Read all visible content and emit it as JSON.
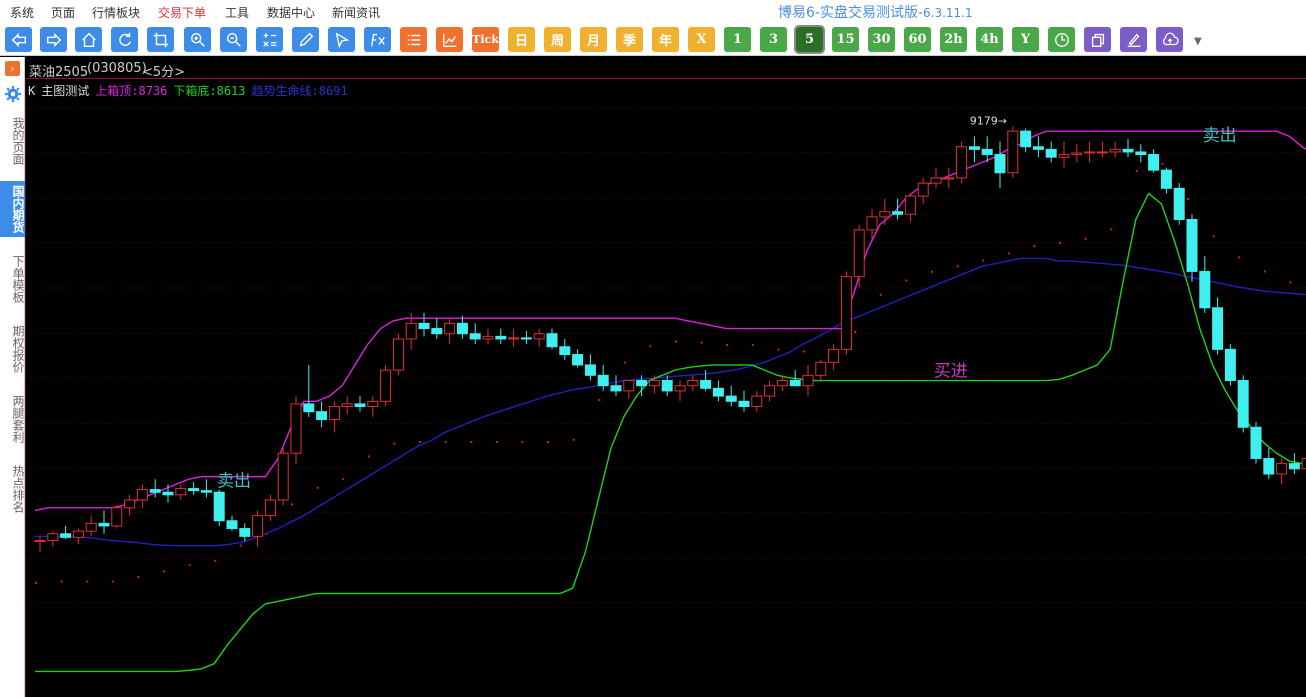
{
  "menu": [
    "系统",
    "页面",
    "行情板块",
    "交易下单",
    "工具",
    "数据中心",
    "新闻资讯"
  ],
  "menu_active": "交易下单",
  "app_title": "博易6-实盘交易测试版-",
  "app_version": "6.3.11.1",
  "toolbar": {
    "icons": [
      "back-icon",
      "forward-icon",
      "home-icon",
      "refresh-icon",
      "crop-icon",
      "zoom-in-icon",
      "zoom-out-icon",
      "formula-icon",
      "draw-icon",
      "cursor-icon",
      "function-icon",
      "list-icon",
      "trend-icon"
    ],
    "tick_label": "Tick",
    "periods": [
      "日",
      "周",
      "月",
      "季",
      "年"
    ],
    "minutes": [
      "X",
      "1",
      "3",
      "5",
      "15",
      "30",
      "60",
      "2h",
      "4h",
      "Y"
    ],
    "selected_minute": "5",
    "extra_icons": [
      "clock-icon",
      "layers-icon",
      "sign-icon",
      "upload-icon"
    ],
    "more": "▼"
  },
  "sidebar": {
    "toggle": "›",
    "items": [
      "我的页面",
      "国内期货",
      "下单模板",
      "期权报价",
      "两腿套利",
      "热点排名"
    ],
    "active_index": 1
  },
  "chart_header": {
    "symbol": "菜油2505",
    "code": "(030805)",
    "period": "<5分>"
  },
  "legend": {
    "k": "K",
    "title": "主图测试",
    "upper": "上箱顶:8736",
    "lower": "下箱底:8613",
    "trend": "趋势生命线:8691"
  },
  "colors": {
    "up": "#e03030",
    "down": "#40f0f0",
    "upper": "#e020e0",
    "lower": "#20d020",
    "trend": "#2020c0",
    "dots": "#d02020",
    "signal_sell": "#40c0c0",
    "signal_buy": "#c040c0"
  },
  "chart_data": {
    "type": "candlestick",
    "title": "主图测试",
    "peak_label": "9179",
    "signals": [
      {
        "label": "卖出",
        "bar": 15
      },
      {
        "label": "买进",
        "bar": 71
      },
      {
        "label": "卖出",
        "bar": 92
      }
    ],
    "ohlc": [
      [
        8380,
        8390,
        8360,
        8382
      ],
      [
        8382,
        8400,
        8370,
        8395
      ],
      [
        8395,
        8410,
        8385,
        8388
      ],
      [
        8388,
        8405,
        8375,
        8400
      ],
      [
        8400,
        8430,
        8390,
        8415
      ],
      [
        8415,
        8440,
        8395,
        8410
      ],
      [
        8410,
        8450,
        8405,
        8445
      ],
      [
        8445,
        8470,
        8430,
        8460
      ],
      [
        8460,
        8490,
        8445,
        8480
      ],
      [
        8480,
        8500,
        8465,
        8475
      ],
      [
        8475,
        8490,
        8455,
        8470
      ],
      [
        8470,
        8490,
        8460,
        8482
      ],
      [
        8482,
        8495,
        8470,
        8478
      ],
      [
        8478,
        8500,
        8465,
        8475
      ],
      [
        8475,
        8480,
        8410,
        8420
      ],
      [
        8420,
        8430,
        8400,
        8405
      ],
      [
        8405,
        8415,
        8380,
        8390
      ],
      [
        8390,
        8440,
        8370,
        8430
      ],
      [
        8430,
        8470,
        8420,
        8460
      ],
      [
        8460,
        8560,
        8450,
        8550
      ],
      [
        8550,
        8660,
        8530,
        8645
      ],
      [
        8645,
        8720,
        8620,
        8630
      ],
      [
        8630,
        8650,
        8600,
        8615
      ],
      [
        8615,
        8650,
        8590,
        8640
      ],
      [
        8640,
        8660,
        8625,
        8645
      ],
      [
        8645,
        8660,
        8630,
        8640
      ],
      [
        8640,
        8660,
        8620,
        8650
      ],
      [
        8650,
        8720,
        8640,
        8710
      ],
      [
        8710,
        8780,
        8700,
        8770
      ],
      [
        8770,
        8820,
        8750,
        8800
      ],
      [
        8800,
        8820,
        8775,
        8790
      ],
      [
        8790,
        8810,
        8770,
        8780
      ],
      [
        8780,
        8810,
        8760,
        8800
      ],
      [
        8800,
        8815,
        8770,
        8780
      ],
      [
        8780,
        8800,
        8760,
        8770
      ],
      [
        8770,
        8790,
        8760,
        8775
      ],
      [
        8775,
        8790,
        8760,
        8770
      ],
      [
        8770,
        8790,
        8755,
        8772
      ],
      [
        8772,
        8785,
        8760,
        8770
      ],
      [
        8770,
        8790,
        8755,
        8780
      ],
      [
        8780,
        8790,
        8750,
        8755
      ],
      [
        8755,
        8770,
        8730,
        8740
      ],
      [
        8740,
        8750,
        8715,
        8720
      ],
      [
        8720,
        8740,
        8690,
        8700
      ],
      [
        8700,
        8720,
        8670,
        8680
      ],
      [
        8680,
        8700,
        8660,
        8670
      ],
      [
        8670,
        8690,
        8655,
        8690
      ],
      [
        8690,
        8700,
        8660,
        8680
      ],
      [
        8680,
        8700,
        8665,
        8690
      ],
      [
        8690,
        8700,
        8660,
        8670
      ],
      [
        8670,
        8690,
        8650,
        8680
      ],
      [
        8680,
        8700,
        8670,
        8690
      ],
      [
        8690,
        8710,
        8670,
        8675
      ],
      [
        8675,
        8690,
        8650,
        8660
      ],
      [
        8660,
        8680,
        8640,
        8650
      ],
      [
        8650,
        8670,
        8630,
        8640
      ],
      [
        8640,
        8670,
        8630,
        8660
      ],
      [
        8660,
        8690,
        8650,
        8680
      ],
      [
        8680,
        8700,
        8670,
        8690
      ],
      [
        8690,
        8710,
        8680,
        8680
      ],
      [
        8680,
        8720,
        8660,
        8700
      ],
      [
        8700,
        8730,
        8690,
        8725
      ],
      [
        8725,
        8760,
        8710,
        8750
      ],
      [
        8750,
        8900,
        8740,
        8890
      ],
      [
        8890,
        8990,
        8870,
        8980
      ],
      [
        8980,
        9020,
        8960,
        9005
      ],
      [
        9005,
        9040,
        8990,
        9015
      ],
      [
        9015,
        9040,
        9000,
        9010
      ],
      [
        9010,
        9050,
        8995,
        9045
      ],
      [
        9045,
        9080,
        9030,
        9070
      ],
      [
        9070,
        9100,
        9060,
        9080
      ],
      [
        9080,
        9100,
        9060,
        9080
      ],
      [
        9080,
        9150,
        9070,
        9140
      ],
      [
        9140,
        9160,
        9110,
        9135
      ],
      [
        9135,
        9160,
        9110,
        9125
      ],
      [
        9125,
        9150,
        9060,
        9090
      ],
      [
        9090,
        9179,
        9080,
        9170
      ],
      [
        9170,
        9175,
        9130,
        9140
      ],
      [
        9140,
        9160,
        9120,
        9135
      ],
      [
        9135,
        9150,
        9110,
        9120
      ],
      [
        9120,
        9150,
        9100,
        9125
      ],
      [
        9125,
        9145,
        9110,
        9128
      ],
      [
        9128,
        9150,
        9110,
        9130
      ],
      [
        9130,
        9150,
        9120,
        9130
      ],
      [
        9130,
        9150,
        9120,
        9135
      ],
      [
        9135,
        9155,
        9120,
        9130
      ],
      [
        9130,
        9145,
        9110,
        9125
      ],
      [
        9125,
        9135,
        9090,
        9095
      ],
      [
        9095,
        9100,
        9050,
        9060
      ],
      [
        9060,
        9070,
        8990,
        9000
      ],
      [
        9000,
        9010,
        8880,
        8900
      ],
      [
        8900,
        8930,
        8820,
        8830
      ],
      [
        8830,
        8850,
        8740,
        8750
      ],
      [
        8750,
        8760,
        8680,
        8690
      ],
      [
        8690,
        8700,
        8590,
        8600
      ],
      [
        8600,
        8610,
        8530,
        8540
      ],
      [
        8540,
        8560,
        8500,
        8510
      ],
      [
        8510,
        8540,
        8490,
        8530
      ],
      [
        8530,
        8550,
        8510,
        8520
      ],
      [
        8520,
        8550,
        8505,
        8540
      ],
      [
        8540,
        8560,
        8520,
        8530
      ],
      [
        8530,
        8545,
        8510,
        8520
      ],
      [
        8520,
        8530,
        8440,
        8450
      ]
    ],
    "upper_line": [
      8440,
      8445,
      8445,
      8445,
      8445,
      8445,
      8445,
      8450,
      8460,
      8470,
      8480,
      8490,
      8500,
      8505,
      8505,
      8505,
      8505,
      8505,
      8505,
      8540,
      8600,
      8650,
      8650,
      8660,
      8680,
      8720,
      8760,
      8790,
      8805,
      8810,
      8810,
      8810,
      8810,
      8810,
      8810,
      8810,
      8810,
      8810,
      8810,
      8810,
      8810,
      8810,
      8810,
      8810,
      8810,
      8810,
      8810,
      8810,
      8810,
      8810,
      8810,
      8805,
      8800,
      8795,
      8790,
      8790,
      8790,
      8790,
      8790,
      8790,
      8790,
      8790,
      8790,
      8790,
      8860,
      8940,
      8990,
      9010,
      9040,
      9060,
      9070,
      9080,
      9090,
      9100,
      9110,
      9120,
      9135,
      9145,
      9160,
      9170,
      9170,
      9170,
      9170,
      9170,
      9170,
      9170,
      9170,
      9170,
      9170,
      9170,
      9170,
      9170,
      9170,
      9170,
      9170,
      9170,
      9170,
      9170,
      9160,
      9140,
      9125,
      9120,
      9120,
      9120,
      9120
    ],
    "lower_line": [
      8130,
      8130,
      8130,
      8130,
      8130,
      8130,
      8130,
      8130,
      8130,
      8130,
      8130,
      8130,
      8132,
      8135,
      8145,
      8180,
      8210,
      8240,
      8260,
      8265,
      8270,
      8275,
      8280,
      8280,
      8280,
      8280,
      8280,
      8280,
      8280,
      8280,
      8280,
      8280,
      8280,
      8280,
      8280,
      8280,
      8280,
      8280,
      8280,
      8280,
      8280,
      8280,
      8290,
      8360,
      8460,
      8560,
      8620,
      8660,
      8690,
      8700,
      8710,
      8715,
      8718,
      8720,
      8720,
      8720,
      8720,
      8710,
      8700,
      8695,
      8692,
      8690,
      8690,
      8690,
      8690,
      8690,
      8690,
      8690,
      8690,
      8690,
      8690,
      8690,
      8690,
      8690,
      8690,
      8690,
      8690,
      8690,
      8690,
      8690,
      8692,
      8700,
      8710,
      8720,
      8750,
      8880,
      9000,
      9050,
      9030,
      8960,
      8880,
      8790,
      8720,
      8670,
      8630,
      8600,
      8570,
      8550,
      8535,
      8530,
      8525,
      8520,
      8515,
      8515,
      8515
    ],
    "trend_line": [
      8390,
      8390,
      8390,
      8390,
      8388,
      8385,
      8382,
      8380,
      8378,
      8375,
      8373,
      8372,
      8372,
      8372,
      8372,
      8374,
      8378,
      8385,
      8395,
      8405,
      8418,
      8430,
      8445,
      8460,
      8475,
      8490,
      8505,
      8520,
      8535,
      8550,
      8565,
      8575,
      8590,
      8600,
      8610,
      8620,
      8628,
      8636,
      8644,
      8652,
      8660,
      8666,
      8672,
      8676,
      8680,
      8685,
      8690,
      8692,
      8694,
      8696,
      8698,
      8700,
      8702,
      8704,
      8708,
      8712,
      8718,
      8725,
      8735,
      8745,
      8760,
      8772,
      8785,
      8800,
      8810,
      8820,
      8830,
      8840,
      8850,
      8860,
      8870,
      8880,
      8890,
      8900,
      8910,
      8915,
      8920,
      8925,
      8925,
      8925,
      8920,
      8920,
      8918,
      8916,
      8914,
      8912,
      8908,
      8904,
      8900,
      8896,
      8890,
      8885,
      8880,
      8875,
      8870,
      8866,
      8862,
      8860,
      8858,
      8856,
      8854,
      8852,
      8850,
      8848,
      8846
    ]
  }
}
